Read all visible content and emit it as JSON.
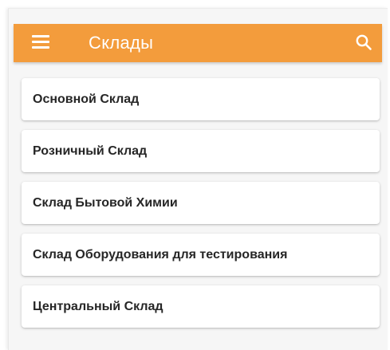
{
  "appbar": {
    "title": "Склады",
    "menu_icon": "hamburger-menu-icon",
    "search_icon": "search-icon",
    "accent_color": "#f39c3c"
  },
  "warehouses": [
    {
      "label": "Основной Склад"
    },
    {
      "label": "Розничный Склад"
    },
    {
      "label": "Склад Бытовой Химии"
    },
    {
      "label": "Склад Оборудования для тестирования"
    },
    {
      "label": "Центральный Склад"
    }
  ]
}
